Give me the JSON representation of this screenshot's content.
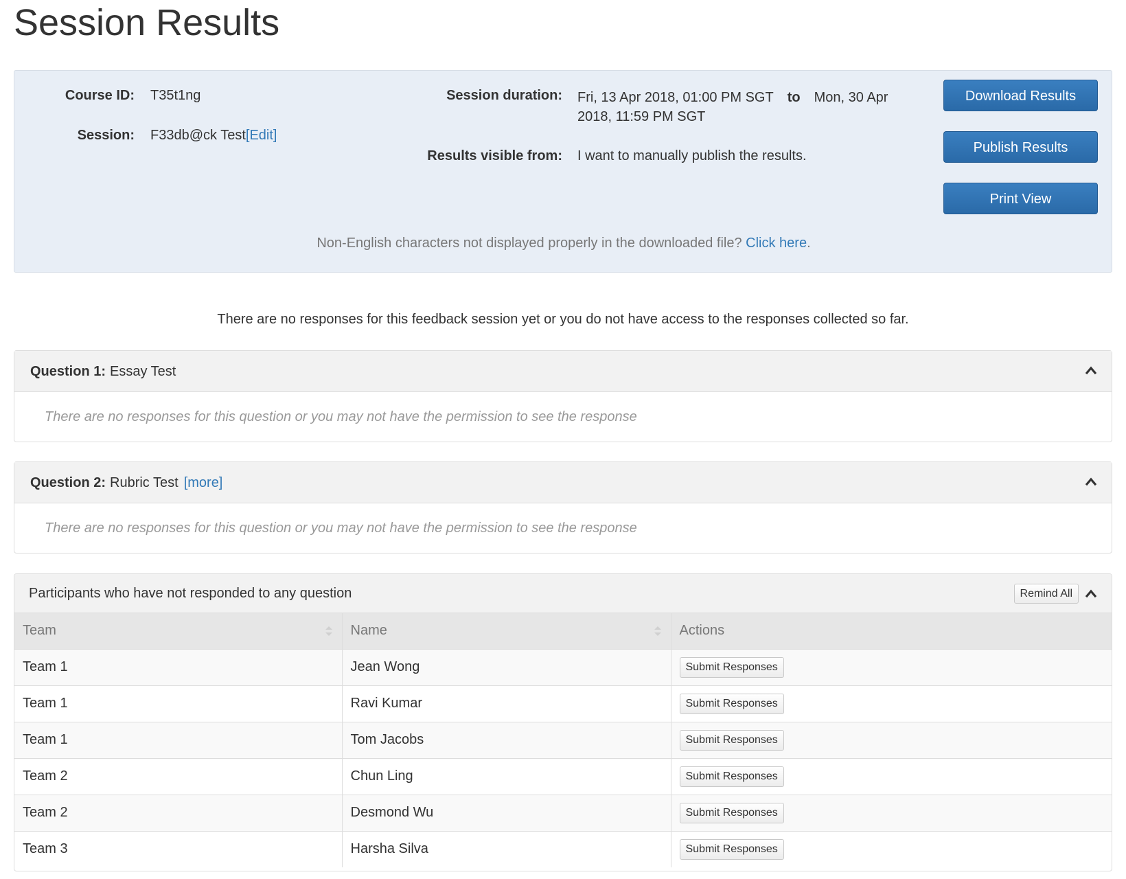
{
  "page_title": "Session Results",
  "info": {
    "course_id_label": "Course ID:",
    "course_id": "T35t1ng",
    "session_label": "Session:",
    "session_name": "F33db@ck Test",
    "edit_link": "[Edit]",
    "duration_label": "Session duration:",
    "duration_start": "Fri, 13 Apr 2018, 01:00 PM SGT",
    "duration_to": "to",
    "duration_end": "Mon, 30 Apr 2018, 11:59 PM SGT",
    "visible_label": "Results visible from:",
    "visible_value": "I want to manually publish the results.",
    "nonenglish_text": "Non-English characters not displayed properly in the downloaded file? ",
    "click_here": "Click here",
    "period": "."
  },
  "buttons": {
    "download": "Download Results",
    "publish": "Publish Results",
    "print": "Print View"
  },
  "no_responses_message": "There are no responses for this feedback session yet or you do not have access to the responses collected so far.",
  "questions": [
    {
      "number_label": "Question 1:",
      "text": "Essay Test",
      "more": "",
      "empty_text": "There are no responses for this question or you may not have the permission to see the response"
    },
    {
      "number_label": "Question 2:",
      "text": "Rubric Test",
      "more": "[more]",
      "empty_text": "There are no responses for this question or you may not have the permission to see the response"
    }
  ],
  "participants": {
    "heading": "Participants who have not responded to any question",
    "remind_all": "Remind All",
    "columns": [
      "Team",
      "Name",
      "Actions"
    ],
    "action_label": "Submit Responses",
    "rows": [
      {
        "team": "Team 1",
        "name": "Jean Wong"
      },
      {
        "team": "Team 1",
        "name": "Ravi Kumar"
      },
      {
        "team": "Team 1",
        "name": "Tom Jacobs"
      },
      {
        "team": "Team 2",
        "name": "Chun Ling"
      },
      {
        "team": "Team 2",
        "name": "Desmond Wu"
      },
      {
        "team": "Team 3",
        "name": "Harsha Silva"
      }
    ]
  },
  "icons": {
    "collapse": "chevron-up-icon",
    "sort": "sort-icon"
  },
  "colors": {
    "primary": "#337ab7",
    "panel_bg": "#e8eef6",
    "link": "#337ab7"
  }
}
